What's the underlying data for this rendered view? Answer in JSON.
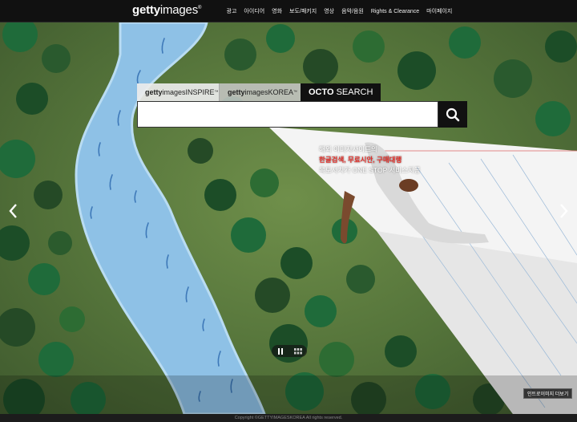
{
  "header": {
    "logo_bold": "getty",
    "logo_light": "images",
    "logo_mark": "®",
    "nav": [
      "광고",
      "아이디어",
      "영화",
      "보도/패키지",
      "영상",
      "음악/음원",
      "Rights & Clearance",
      "마이페이지"
    ]
  },
  "search": {
    "tabs": {
      "inspire_bold": "getty",
      "inspire_light": "imagesINSPIRE",
      "korea_bold": "getty",
      "korea_light": "imagesKOREA",
      "tm": "™",
      "octo_bold": "OCTO",
      "octo_light": "SEARCH"
    },
    "placeholder": "",
    "button_icon": "search-icon"
  },
  "promo": {
    "line1": "해외 이미지사이트의",
    "line2": "한글검색, 무료시안, 구매대행",
    "line3": "옥토서치가 ONE STOP 서비스지공"
  },
  "controls": {
    "prev_icon": "chevron-left-icon",
    "next_icon": "chevron-right-icon",
    "pause_icon": "pause-icon",
    "grid_icon": "grid-icon",
    "intro_label": "인트로이미지 더보기"
  },
  "footer": {
    "copyright": "Copyright ©GETTYIMAGESKOREA All rights reserved."
  },
  "colors": {
    "accent_red": "#e8302a",
    "header_bg": "#111111"
  }
}
